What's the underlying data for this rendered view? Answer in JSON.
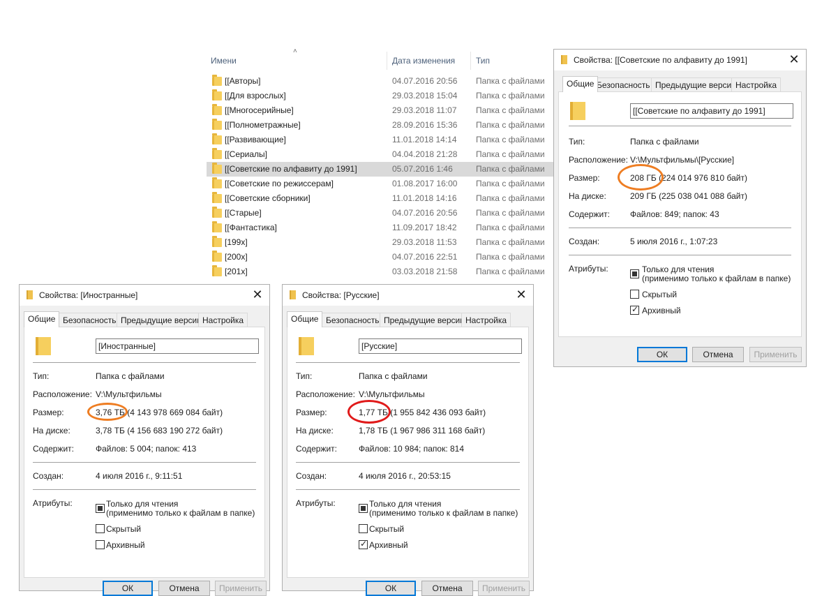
{
  "explorer": {
    "columns": {
      "name": "Имени",
      "date": "Дата изменения",
      "type": "Тип"
    },
    "rows": [
      {
        "name": "[[Авторы]",
        "date": "04.07.2016 20:56",
        "type": "Папка с файлами"
      },
      {
        "name": "[[Для взрослых]",
        "date": "29.03.2018 15:04",
        "type": "Папка с файлами"
      },
      {
        "name": "[[Многосерийные]",
        "date": "29.03.2018 11:07",
        "type": "Папка с файлами"
      },
      {
        "name": "[[Полнометражные]",
        "date": "28.09.2016 15:36",
        "type": "Папка с файлами"
      },
      {
        "name": "[[Развивающие]",
        "date": "11.01.2018 14:14",
        "type": "Папка с файлами"
      },
      {
        "name": "[[Сериалы]",
        "date": "04.04.2018 21:28",
        "type": "Папка с файлами"
      },
      {
        "name": "[[Советские по алфавиту до 1991]",
        "date": "05.07.2016 1:46",
        "type": "Папка с файлами",
        "selected": true
      },
      {
        "name": "[[Советские по режиссерам]",
        "date": "01.08.2017 16:00",
        "type": "Папка с файлами"
      },
      {
        "name": "[[Советские сборники]",
        "date": "11.01.2018 14:16",
        "type": "Папка с файлами"
      },
      {
        "name": "[[Старые]",
        "date": "04.07.2016 20:56",
        "type": "Папка с файлами"
      },
      {
        "name": "[[Фантастика]",
        "date": "11.09.2017 18:42",
        "type": "Папка с файлами"
      },
      {
        "name": "[199x]",
        "date": "29.03.2018 11:53",
        "type": "Папка с файлами"
      },
      {
        "name": "[200x]",
        "date": "04.07.2016 22:51",
        "type": "Папка с файлами"
      },
      {
        "name": "[201x]",
        "date": "03.03.2018 21:58",
        "type": "Папка с файлами"
      }
    ]
  },
  "tabs": [
    "Общие",
    "Безопасность",
    "Предыдущие версии",
    "Настройка"
  ],
  "labels": {
    "type": "Тип:",
    "location": "Расположение:",
    "size": "Размер:",
    "on_disk": "На диске:",
    "contains": "Содержит:",
    "created": "Создан:",
    "attributes": "Атрибуты:",
    "readonly": "Только для чтения",
    "readonly_note": "(применимо только к файлам в папке)",
    "hidden": "Скрытый",
    "archive": "Архивный",
    "ok": "ОК",
    "cancel": "Отмена",
    "apply": "Применить"
  },
  "dialogs": {
    "soviet": {
      "title": "Свойства: [[Советские по алфавиту до 1991]",
      "name": "[[Советские по алфавиту до 1991]",
      "type": "Папка с файлами",
      "location": "V:\\Мультфильмы\\[Русские]",
      "size": "208 ГБ (224 014 976 810 байт)",
      "on_disk": "209 ГБ (225 038 041 088 байт)",
      "contains": "Файлов: 849; папок: 43",
      "created": "5 июля 2016 г., 1:07:23",
      "hidden_checked": false,
      "archive_checked": true
    },
    "foreign": {
      "title": "Свойства: [Иностранные]",
      "name": "[Иностранные]",
      "type": "Папка с файлами",
      "location": "V:\\Мультфильмы",
      "size": "3,76 ТБ (4 143 978 669 084 байт)",
      "on_disk": "3,78 ТБ (4 156 683 190 272 байт)",
      "contains": "Файлов: 5 004; папок: 413",
      "created": "4 июля 2016 г., 9:11:51",
      "hidden_checked": false,
      "archive_checked": false
    },
    "russian": {
      "title": "Свойства: [Русские]",
      "name": "[Русские]",
      "type": "Папка с файлами",
      "location": "V:\\Мультфильмы",
      "size": "1,77 ТБ (1 955 842 436 093 байт)",
      "on_disk": "1,78 ТБ (1 967 986 311 168 байт)",
      "contains": "Файлов: 10 984; папок: 814",
      "created": "4 июля 2016 г., 20:53:15",
      "hidden_checked": false,
      "archive_checked": true
    }
  },
  "colors": {
    "highlight_orange": "#ee7d22",
    "highlight_red": "#e01a1a",
    "selection": "#d9d9d9",
    "default_button_border": "#0078d7"
  }
}
